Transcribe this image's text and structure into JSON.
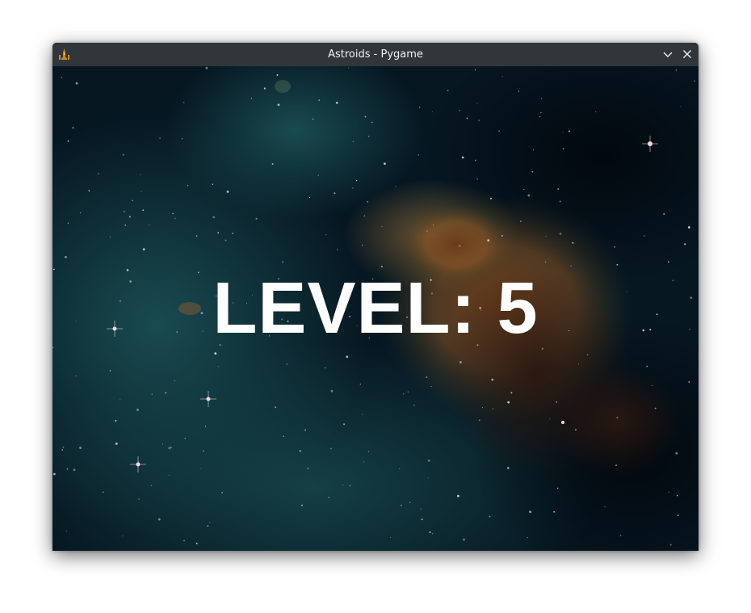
{
  "window": {
    "title": "Astroids - Pygame",
    "app_icon": "spaceship-icon",
    "controls": {
      "minimize_icon": "chevron-down-icon",
      "close_icon": "close-icon"
    }
  },
  "game": {
    "background": "nebula-starfield",
    "level_text": "LEVEL: 5"
  },
  "colors": {
    "titlebar": "#31363b",
    "title_text": "#eff0f1",
    "level_text": "#ffffff",
    "nebula_teal": "#0c3a3e",
    "nebula_orange": "#a0622a"
  }
}
